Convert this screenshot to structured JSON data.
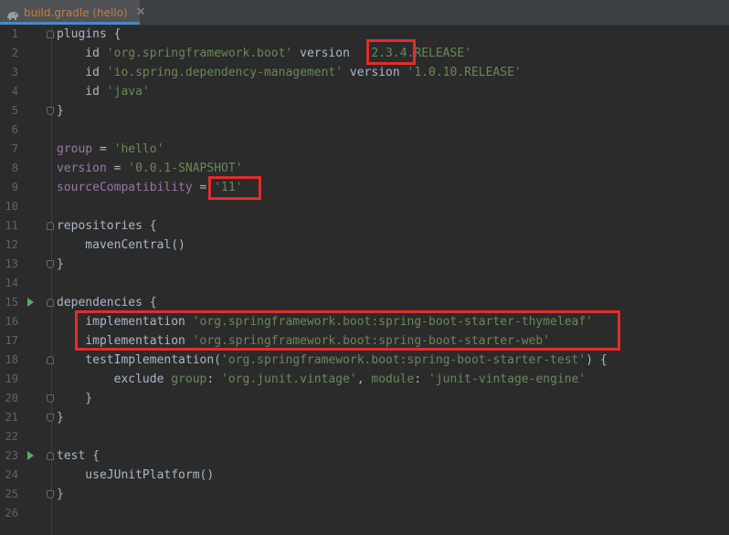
{
  "tab": {
    "title": "build.gradle (hello)",
    "close_glyph": "✕",
    "icon": "gradle-elephant-icon"
  },
  "lines": [
    {
      "n": "1",
      "tokens": [
        {
          "t": "plugins {",
          "c": ""
        }
      ]
    },
    {
      "n": "2",
      "tokens": [
        {
          "t": "    id ",
          "c": ""
        },
        {
          "t": "'org.springframework.boot'",
          "c": "str"
        },
        {
          "t": " version  ",
          "c": ""
        },
        {
          "t": "'2.3.4.RELEASE'",
          "c": "str"
        }
      ]
    },
    {
      "n": "3",
      "tokens": [
        {
          "t": "    id ",
          "c": ""
        },
        {
          "t": "'io.spring.dependency-management'",
          "c": "str"
        },
        {
          "t": " version ",
          "c": ""
        },
        {
          "t": "'1.0.10.RELEASE'",
          "c": "str"
        }
      ]
    },
    {
      "n": "4",
      "tokens": [
        {
          "t": "    id ",
          "c": ""
        },
        {
          "t": "'java'",
          "c": "str"
        }
      ]
    },
    {
      "n": "5",
      "tokens": [
        {
          "t": "}",
          "c": ""
        }
      ]
    },
    {
      "n": "6",
      "tokens": []
    },
    {
      "n": "7",
      "tokens": [
        {
          "t": "group",
          "c": "prop"
        },
        {
          "t": " = ",
          "c": ""
        },
        {
          "t": "'hello'",
          "c": "str"
        }
      ]
    },
    {
      "n": "8",
      "tokens": [
        {
          "t": "version",
          "c": "prop"
        },
        {
          "t": " = ",
          "c": ""
        },
        {
          "t": "'0.0.1-SNAPSHOT'",
          "c": "str"
        }
      ]
    },
    {
      "n": "9",
      "tokens": [
        {
          "t": "sourceCompatibility",
          "c": "prop"
        },
        {
          "t": " = ",
          "c": ""
        },
        {
          "t": "'11'",
          "c": "str"
        }
      ]
    },
    {
      "n": "10",
      "tokens": []
    },
    {
      "n": "11",
      "tokens": [
        {
          "t": "repositories {",
          "c": ""
        }
      ]
    },
    {
      "n": "12",
      "tokens": [
        {
          "t": "    mavenCentral()",
          "c": ""
        }
      ]
    },
    {
      "n": "13",
      "tokens": [
        {
          "t": "}",
          "c": ""
        }
      ]
    },
    {
      "n": "14",
      "tokens": []
    },
    {
      "n": "15",
      "tokens": [
        {
          "t": "dependencies {",
          "c": ""
        }
      ]
    },
    {
      "n": "16",
      "tokens": [
        {
          "t": "    implementation ",
          "c": ""
        },
        {
          "t": "'org.springframework.boot:spring-boot-starter-thymeleaf'",
          "c": "str"
        }
      ]
    },
    {
      "n": "17",
      "tokens": [
        {
          "t": "    implementation ",
          "c": ""
        },
        {
          "t": "'org.springframework.boot:spring-boot-starter-web'",
          "c": "str"
        }
      ]
    },
    {
      "n": "18",
      "tokens": [
        {
          "t": "    testImplementation(",
          "c": ""
        },
        {
          "t": "'org.springframework.boot:spring-boot-starter-test'",
          "c": "str"
        },
        {
          "t": ") {",
          "c": ""
        }
      ]
    },
    {
      "n": "19",
      "tokens": [
        {
          "t": "        exclude ",
          "c": ""
        },
        {
          "t": "group",
          "c": "str"
        },
        {
          "t": ": ",
          "c": ""
        },
        {
          "t": "'org.junit.vintage'",
          "c": "str"
        },
        {
          "t": ", ",
          "c": ""
        },
        {
          "t": "module",
          "c": "str"
        },
        {
          "t": ": ",
          "c": ""
        },
        {
          "t": "'junit-vintage-engine'",
          "c": "str"
        }
      ]
    },
    {
      "n": "20",
      "tokens": [
        {
          "t": "    }",
          "c": ""
        }
      ]
    },
    {
      "n": "21",
      "tokens": [
        {
          "t": "}",
          "c": ""
        }
      ]
    },
    {
      "n": "22",
      "tokens": []
    },
    {
      "n": "23",
      "tokens": [
        {
          "t": "test {",
          "c": ""
        }
      ]
    },
    {
      "n": "24",
      "tokens": [
        {
          "t": "    useJUnitPlatform()",
          "c": ""
        }
      ]
    },
    {
      "n": "25",
      "tokens": [
        {
          "t": "}",
          "c": ""
        }
      ]
    },
    {
      "n": "26",
      "tokens": []
    }
  ],
  "run_gutter_lines": [
    "15",
    "23"
  ],
  "fold_start_lines": [
    "1",
    "11",
    "15",
    "18",
    "23"
  ],
  "fold_end_lines": [
    "5",
    "13",
    "20",
    "21",
    "25"
  ],
  "colors": {
    "background": "#2b2b2b",
    "default_text": "#a9b7c6",
    "string": "#6a8759",
    "property": "#9876aa",
    "line_number": "#606366",
    "annotation_box": "#e52b2b",
    "run_icon": "#59a869",
    "tab_text": "#c27c47"
  }
}
